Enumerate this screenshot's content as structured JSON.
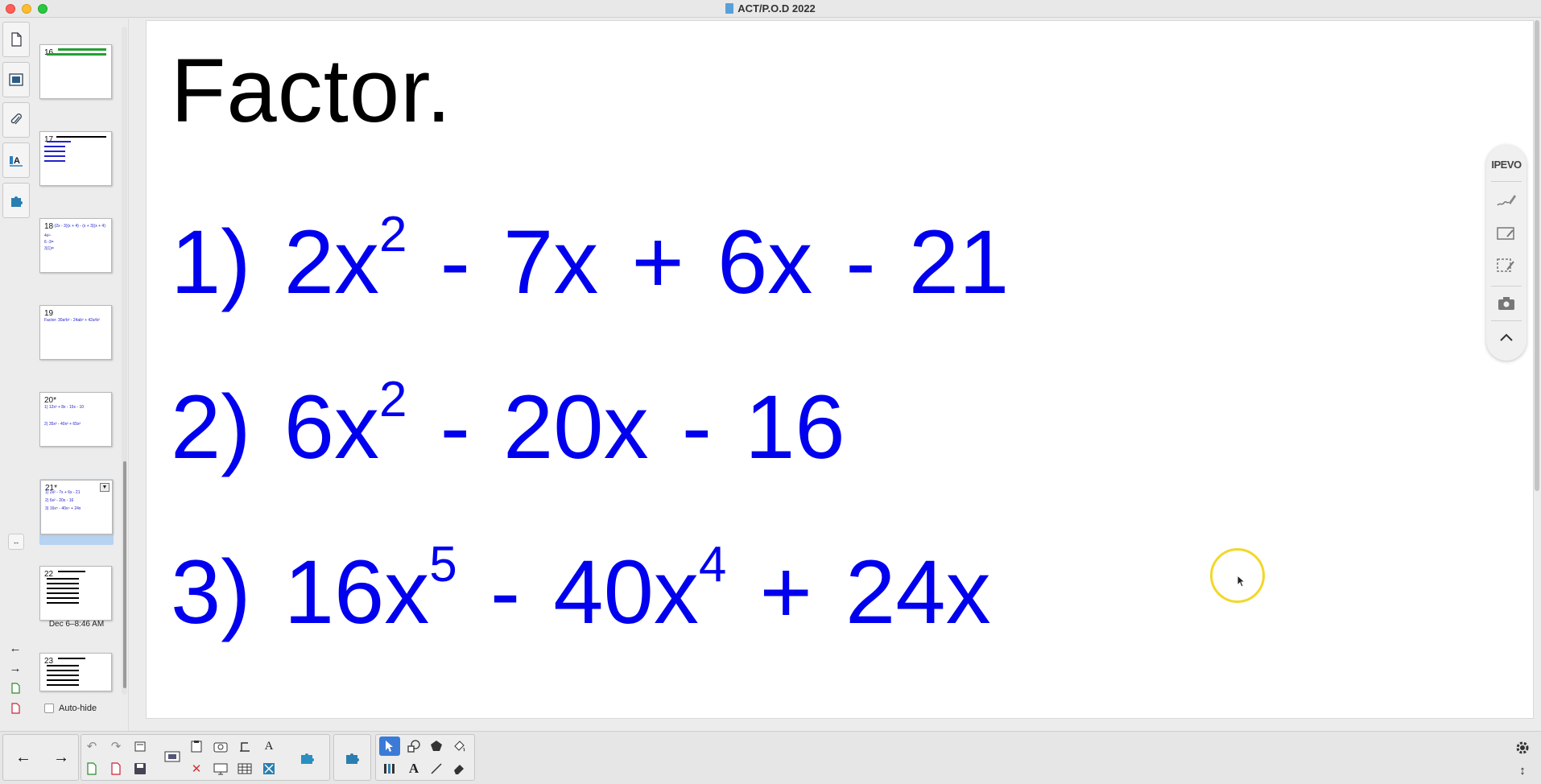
{
  "window": {
    "title": "ACT/P.O.D 2022"
  },
  "sidebar": {
    "pages": [
      {
        "num": "16",
        "lines": []
      },
      {
        "num": "17",
        "lines": []
      },
      {
        "num": "18",
        "lines": [
          "-(2x - 3)(x + 4) - (x + 3)(x + 4)",
          "4x²-",
          "6 -3=",
          "3(1)="
        ]
      },
      {
        "num": "19",
        "lines": [
          "Factor: 30a²b² - 24ab² + 42a²b²"
        ]
      },
      {
        "num": "20*",
        "lines": [
          "1) 12x² + 8x - 15x - 10",
          "2) 35x² - 40x² + 65x²"
        ]
      },
      {
        "num": "21*",
        "lines": [
          "1) 2x² - 7x + 6x - 21",
          "2) 6x² - 20x - 16",
          "3) 16x⁵ - 40x⁴ + 24x"
        ]
      },
      {
        "num": "22",
        "lines": []
      },
      {
        "num": "23",
        "lines": []
      }
    ],
    "date_label": "Dec 6–8:46 AM",
    "autohide_label": "Auto-hide"
  },
  "slide": {
    "title": "Factor.",
    "problems": [
      {
        "prefix": "1) 2x",
        "exp": "2",
        "suffix": " - 7x + 6x - 21"
      },
      {
        "prefix": "2) 6x",
        "exp": "2",
        "suffix": " - 20x - 16"
      },
      {
        "prefix": "3) 16x",
        "exp": "5",
        "mid": " - 40x",
        "exp2": "4",
        "suffix": " + 24x"
      }
    ]
  },
  "ipevo": {
    "logo": "IPEVO"
  },
  "colors": {
    "problem_text": "#0000ee",
    "selection": "#3b7bd8",
    "highlight_ring": "#f2d72a"
  }
}
